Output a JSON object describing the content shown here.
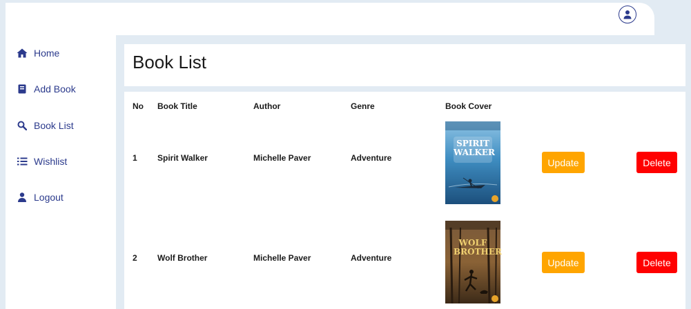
{
  "nav": {
    "items": [
      {
        "label": "Home",
        "icon": "home-icon"
      },
      {
        "label": "Add Book",
        "icon": "book-icon"
      },
      {
        "label": "Book List",
        "icon": "search-icon"
      },
      {
        "label": "Wishlist",
        "icon": "list-icon"
      },
      {
        "label": "Logout",
        "icon": "user-icon"
      }
    ]
  },
  "page": {
    "title": "Book List"
  },
  "table": {
    "headers": [
      "No",
      "Book Title",
      "Author",
      "Genre",
      "Book Cover"
    ],
    "rows": [
      {
        "no": "1",
        "title": "Spirit Walker",
        "author": "Michelle Paver",
        "genre": "Adventure",
        "cover_title": "SPIRIT WALKER",
        "update_label": "Update",
        "delete_label": "Delete"
      },
      {
        "no": "2",
        "title": "Wolf Brother",
        "author": "Michelle Paver",
        "genre": "Adventure",
        "cover_title": "WOLF BROTHER",
        "update_label": "Update",
        "delete_label": "Delete"
      }
    ]
  },
  "colors": {
    "accent": "#2b3a8c",
    "update": "#ffa500",
    "delete": "#ff0000",
    "background": "#e2ebf3"
  }
}
